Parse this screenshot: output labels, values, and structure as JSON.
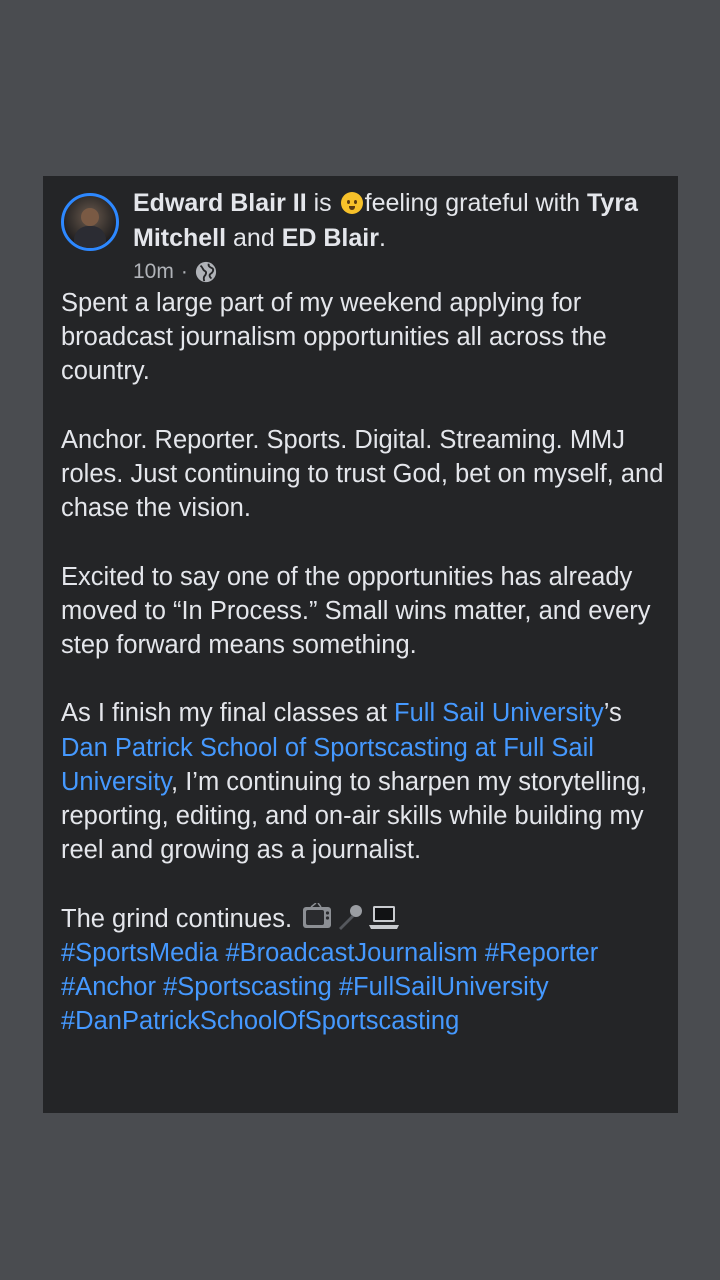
{
  "post": {
    "author": "Edward Blair II",
    "is_word": "is",
    "feeling": "feeling grateful with",
    "tag1": "Tyra Mitchell",
    "and_word": "and",
    "tag2": "ED Blair",
    "period": ".",
    "time": "10m",
    "dot": "·",
    "privacy_icon": "globe-icon",
    "feeling_icon": "grateful-emoji-icon",
    "paragraphs": {
      "p1": "Spent a large part of my weekend applying for broadcast journalism opportunities all across the country.",
      "p2": "Anchor. Reporter. Sports. Digital. Streaming. MMJ roles. Just continuing to trust God, bet on myself, and chase the vision.",
      "p3": "Excited to say one of the opportunities has already moved to “In Process.” Small wins matter, and every step forward means something.",
      "p4_before": "As I finish my final classes at ",
      "p4_link1": "Full Sail University",
      "p4_mid": "’s ",
      "p4_link2": "Dan Patrick School of Sportscasting at Full Sail University",
      "p4_after": ", I’m continuing to sharpen my storytelling, reporting, editing, and on-air skills while building my reel and growing as a journalist.",
      "p5": "The grind continues."
    },
    "emoji_icons": [
      "tv-icon",
      "microphone-icon",
      "laptop-icon"
    ],
    "hashtags": {
      "h1": "#SportsMedia",
      "h2": "#BroadcastJournalism",
      "h3": "#Reporter",
      "h4": "#Anchor",
      "h5": "#Sportscasting",
      "h6": "#FullSailUniversity",
      "h7": "#DanPatrickSchoolOfSportscasting"
    }
  },
  "colors": {
    "background": "#4a4c50",
    "card": "#242527",
    "text": "#e4e6eb",
    "link": "#4599ff",
    "meta": "#b0b3b8",
    "avatar_ring": "#2d88ff"
  }
}
